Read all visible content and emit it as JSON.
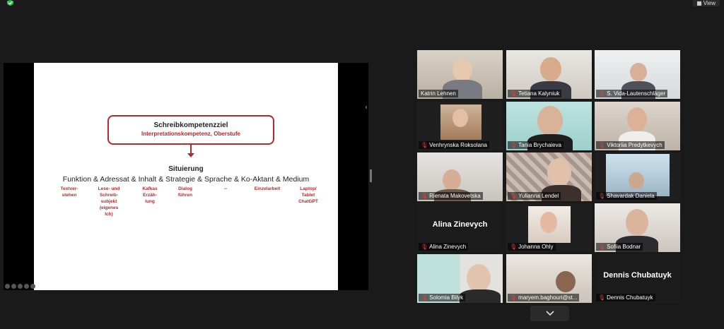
{
  "topbar": {
    "view_label": "View",
    "shield_color": "#2fbf4a"
  },
  "slide": {
    "goal_title": "Schreibkompetenzziel",
    "goal_subtitle": "Interpretationskompetenz, Oberstufe",
    "situation_title": "Situierung",
    "situation_line": "Funktion & Adressat & Inhalt & Strategie & Sprache & Ko-Aktant & Medium",
    "notes": [
      "Textver-\nstehen",
      "Lese- und\nSchreib-\nsubjekt\n(eigenes\nIch)",
      "Kafkas\nErzäh-\nlung",
      "Dialog\nführen",
      "--",
      "Einzelarbeit",
      "Laptop/\nTablet\nChatGPT"
    ],
    "accent_color": "#b12a2a"
  },
  "participants": [
    {
      "name": "Katrin Lehnen",
      "muted": false,
      "active": true
    },
    {
      "name": "Tetiana Kalyniuk",
      "muted": true
    },
    {
      "name": "S. Vida-Lautenschläger",
      "muted": true
    },
    {
      "name": "Venhrynska Roksolana",
      "muted": true
    },
    {
      "name": "Tania Brychaieva",
      "muted": true
    },
    {
      "name": "Viktoriia Predytkevych",
      "muted": true
    },
    {
      "name": "Rienata Makovetska",
      "muted": true
    },
    {
      "name": "Yulianna Lendel",
      "muted": true
    },
    {
      "name": "Shavardak  Daniela",
      "muted": true
    },
    {
      "name": "Alina Zinevych",
      "muted": true,
      "no_video": true,
      "display_name": "Alina Zinevych"
    },
    {
      "name": "Johanna Ohly",
      "muted": true
    },
    {
      "name": "Sofiia Bodnar",
      "muted": true
    },
    {
      "name": "Solomia Bilyk",
      "muted": true
    },
    {
      "name": "maryem.baghouri@st...",
      "muted": true
    },
    {
      "name": "Dennis Chubatuyk",
      "muted": true,
      "no_video": true,
      "display_name": "Dennis Chubatuyk"
    }
  ],
  "gallery": {
    "more_icon": "chevron-down-icon"
  }
}
